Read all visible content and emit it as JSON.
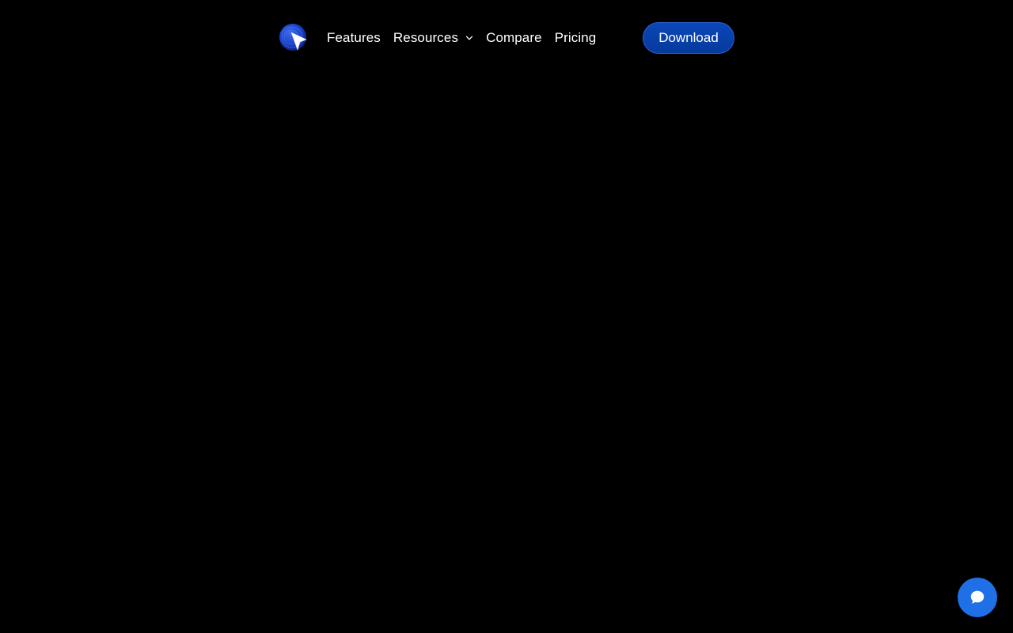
{
  "nav": {
    "logo_icon": "cursor-arrow-logo-icon",
    "items": [
      {
        "label": "Features"
      },
      {
        "label": "Resources",
        "has_dropdown": true
      },
      {
        "label": "Compare"
      },
      {
        "label": "Pricing"
      }
    ],
    "download_label": "Download"
  },
  "chat": {
    "icon": "chat-bubble-icon"
  },
  "colors": {
    "background": "#000000",
    "accent": "#0a47b8",
    "chat_button": "#1f6fe6",
    "text": "#ffffff"
  }
}
